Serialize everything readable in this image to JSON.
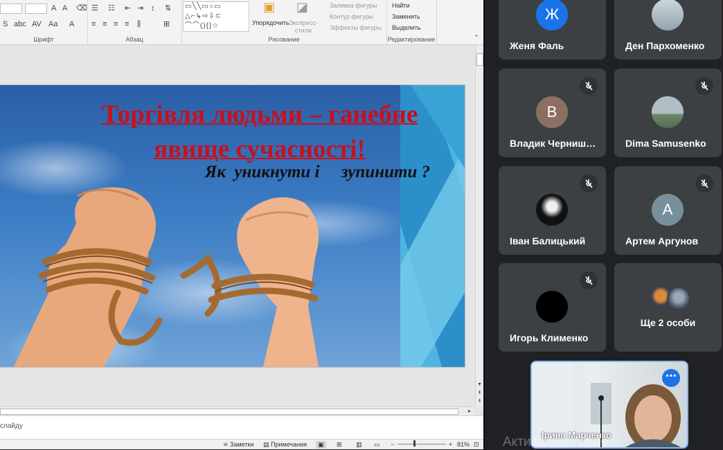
{
  "ribbon": {
    "groups": {
      "font": "Шрифт",
      "paragraph": "Абзац",
      "drawing": "Рисование",
      "editing": "Редактирование"
    },
    "arrange_label": "Упорядочить",
    "quick_styles_label": "Экспресс-стили",
    "shape_fill": "Заливка фигуры",
    "shape_outline": "Контур фигуры",
    "shape_effects": "Эффекты фигуры",
    "find": "Найти",
    "replace": "Заменить",
    "select": "Выделить"
  },
  "slide": {
    "title": "Торгівля людьми – ганебне явище сучасності!",
    "subtitle": "Як  уникнути і     зупинити ?",
    "title_color": "#c8101e"
  },
  "notes": {
    "placeholder_fragment": "слайду"
  },
  "statusbar": {
    "notes": "Заметки",
    "comments": "Примечания",
    "zoom": "81%"
  },
  "meet": {
    "participants": [
      {
        "name": "Женя Фаль",
        "initial": "Ж",
        "avatar_color": "#1a73e8",
        "muted": false
      },
      {
        "name": "Ден Пархоменко",
        "initial": "",
        "avatar_color": "#9fb3c8",
        "muted": false
      },
      {
        "name": "Владик Черниш…",
        "initial": "В",
        "avatar_color": "#8d6e63",
        "muted": true
      },
      {
        "name": "Dima Samusenko",
        "initial": "",
        "avatar_color": "#7f9a8f",
        "muted": true
      },
      {
        "name": "Іван Балицький",
        "initial": "",
        "avatar_color": "#111111",
        "muted": true
      },
      {
        "name": "Артем Аргунов",
        "initial": "А",
        "avatar_color": "#78909c",
        "muted": true
      },
      {
        "name": "Игорь Клименко",
        "initial": "",
        "avatar_color": "#000000",
        "muted": true
      },
      {
        "name": "Ще 2 особи",
        "initial": "",
        "avatar_color": "#3c4043",
        "muted": false
      }
    ],
    "self_name": "Ірина Марченко",
    "watermark": "Активация Window"
  }
}
